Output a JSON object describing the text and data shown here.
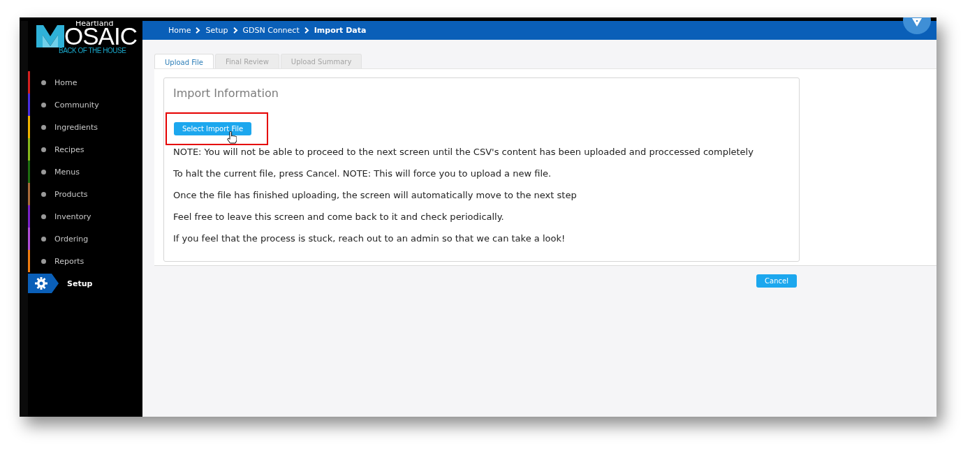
{
  "logo": {
    "brand": "Heartland",
    "name": "OSAIC",
    "tagline": "BACK OF THE HOUSE"
  },
  "sidebar": {
    "items": [
      {
        "label": "Home",
        "color": "#d42020",
        "selected": false
      },
      {
        "label": "Community",
        "color": "#4a2ee0",
        "selected": false
      },
      {
        "label": "Ingredients",
        "color": "#f0b400",
        "selected": false
      },
      {
        "label": "Recipes",
        "color": "#86b81c",
        "selected": false
      },
      {
        "label": "Menus",
        "color": "#1e6e10",
        "selected": false
      },
      {
        "label": "Products",
        "color": "#a86a3a",
        "selected": false
      },
      {
        "label": "Inventory",
        "color": "#7a22c8",
        "selected": false
      },
      {
        "label": "Ordering",
        "color": "#b04ed8",
        "selected": false
      },
      {
        "label": "Reports",
        "color": "#f07c10",
        "selected": false
      },
      {
        "label": "Setup",
        "color": "#0a5fb8",
        "selected": true
      }
    ]
  },
  "breadcrumb": [
    "Home",
    "Setup",
    "GDSN Connect",
    "Import Data"
  ],
  "tabs": [
    {
      "label": "Upload File",
      "selected": true,
      "disabled": false
    },
    {
      "label": "Final Review",
      "selected": false,
      "disabled": true
    },
    {
      "label": "Upload Summary",
      "selected": false,
      "disabled": true
    }
  ],
  "panel": {
    "title": "Import Information",
    "select_button": {
      "label": "Select Import File",
      "highlighted": true
    },
    "notes": [
      "NOTE: You will not be able to proceed to the next screen until the CSV's content has been uploaded and proccessed completely",
      "To halt the current file, press Cancel. NOTE: This will force you to upload a new file.",
      "Once the file has finished uploading, the screen will automatically move to the next step",
      "Feel free to leave this screen and come back to it and check periodically.",
      "If you feel that the process is stuck, reach out to an admin so that we can take a look!"
    ]
  },
  "cancel_button": "Cancel"
}
